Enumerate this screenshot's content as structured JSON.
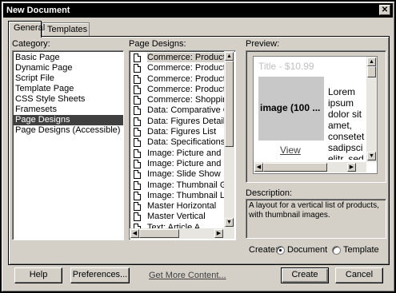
{
  "window": {
    "title": "New Document",
    "close_glyph": "✕"
  },
  "tabs": [
    "General",
    "Templates"
  ],
  "category": {
    "label": "Category:",
    "items": [
      "Basic Page",
      "Dynamic Page",
      "Script File",
      "Template Page",
      "CSS Style Sheets",
      "Framesets",
      "Page Designs",
      "Page Designs (Accessible)"
    ],
    "selected": "Page Designs"
  },
  "designs": {
    "label": "Page Designs:",
    "items": [
      "Commerce: Product Cat",
      "Commerce: Product Cat",
      "Commerce: Product Det",
      "Commerce: Product Det",
      "Commerce: Shopping Ca",
      "Data: Comparative Grid",
      "Data: Figures Detail",
      "Data: Figures List",
      "Data: Specifications",
      "Image: Picture and Desc",
      "Image: Picture and Desc",
      "Image: Slide Show",
      "Image: Thumbnail Grid",
      "Image: Thumbnail List",
      "Master Horizontal",
      "Master Vertical",
      "Text: Article A"
    ],
    "icon": "document-icon"
  },
  "preview": {
    "label": "Preview:",
    "title_text": "Title - $10.99",
    "image_text": "image (100 ...",
    "link_text": "View",
    "body_lines": [
      "Lorem",
      "ipsum",
      "dolor sit",
      "amet,",
      "consetet",
      "sadipsci",
      "elitr, sed"
    ]
  },
  "description": {
    "label": "Description:",
    "text": "A layout for a vertical list of products, with thumbnail images."
  },
  "create": {
    "label": "Create:",
    "options": [
      "Document",
      "Template"
    ],
    "selected": "Document"
  },
  "buttons": {
    "help": "Help",
    "preferences": "Preferences...",
    "get_more": "Get More Content...",
    "create": "Create",
    "cancel": "Cancel"
  }
}
